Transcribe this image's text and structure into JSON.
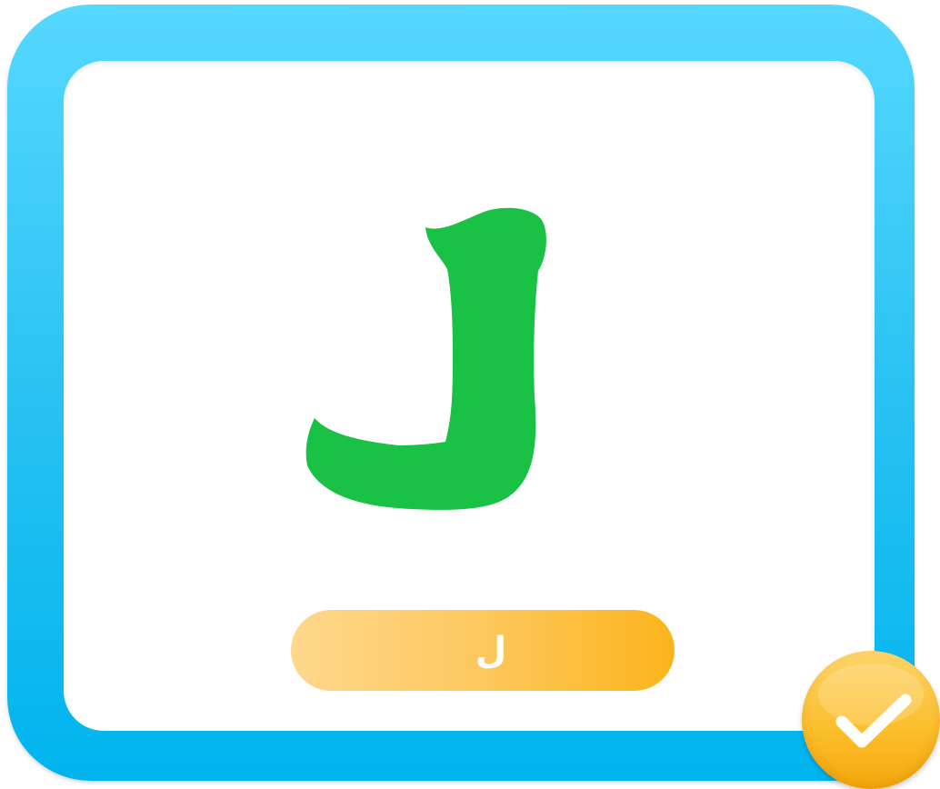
{
  "card": {
    "letter_text": "ل",
    "letter_color": "#19c144",
    "frame_color_top": "#56d8ff",
    "frame_color_bottom": "#00b4ee"
  },
  "answer": {
    "label": "ل",
    "pill_color_start": "#fed88c",
    "pill_color_end": "#fbb41c"
  },
  "status": {
    "icon": "checkmark-icon",
    "state": "correct",
    "badge_color": "#fbbf2e"
  }
}
